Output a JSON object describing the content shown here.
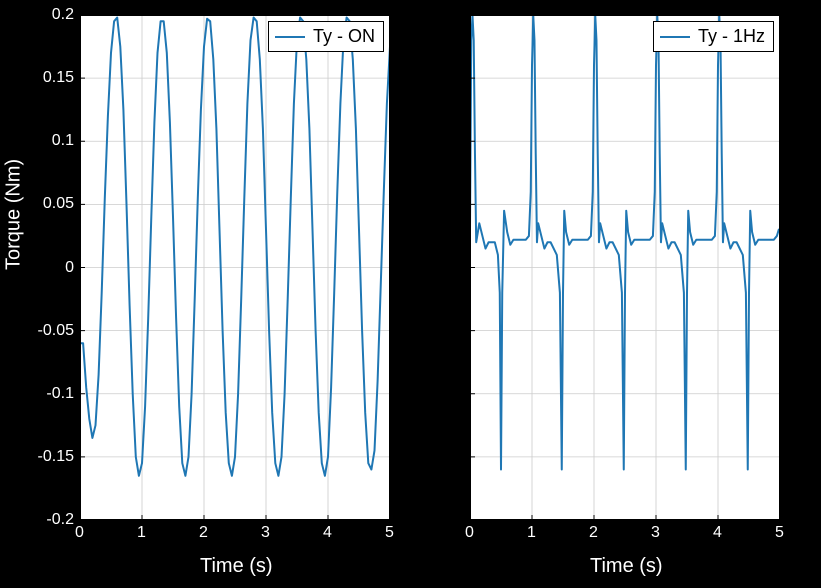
{
  "chart_data": [
    {
      "type": "line",
      "title": "",
      "xlabel": "Time (s)",
      "ylabel": "Torque (Nm)",
      "xlim": [
        0,
        5
      ],
      "ylim": [
        -0.2,
        0.2
      ],
      "xticks": [
        0,
        1,
        2,
        3,
        4,
        5
      ],
      "yticks": [
        -0.2,
        -0.15,
        -0.1,
        -0.05,
        0,
        0.05,
        0.1,
        0.15,
        0.2
      ],
      "legend": [
        "Ty - ON"
      ],
      "legend_pos": "upper right",
      "series": [
        {
          "name": "Ty - ON",
          "color": "#1f77b4",
          "x": [
            0,
            0.05,
            0.1,
            0.15,
            0.2,
            0.25,
            0.3,
            0.35,
            0.4,
            0.45,
            0.5,
            0.55,
            0.6,
            0.65,
            0.7,
            0.75,
            0.8,
            0.85,
            0.9,
            0.95,
            1.0,
            1.05,
            1.1,
            1.15,
            1.2,
            1.25,
            1.3,
            1.35,
            1.4,
            1.45,
            1.5,
            1.55,
            1.6,
            1.65,
            1.7,
            1.75,
            1.8,
            1.85,
            1.9,
            1.95,
            2.0,
            2.05,
            2.1,
            2.15,
            2.2,
            2.25,
            2.3,
            2.35,
            2.4,
            2.45,
            2.5,
            2.55,
            2.6,
            2.65,
            2.7,
            2.75,
            2.8,
            2.85,
            2.9,
            2.95,
            3.0,
            3.05,
            3.1,
            3.15,
            3.2,
            3.25,
            3.3,
            3.35,
            3.4,
            3.45,
            3.5,
            3.55,
            3.6,
            3.65,
            3.7,
            3.75,
            3.8,
            3.85,
            3.9,
            3.95,
            4.0,
            4.05,
            4.1,
            4.15,
            4.2,
            4.25,
            4.3,
            4.35,
            4.4,
            4.45,
            4.5,
            4.55,
            4.6,
            4.65,
            4.7,
            4.75,
            4.8,
            4.85,
            4.9,
            4.95,
            5.0
          ],
          "y": [
            -0.06,
            -0.06,
            -0.095,
            -0.12,
            -0.135,
            -0.125,
            -0.085,
            -0.02,
            0.055,
            0.12,
            0.17,
            0.195,
            0.198,
            0.175,
            0.125,
            0.05,
            -0.03,
            -0.1,
            -0.15,
            -0.165,
            -0.155,
            -0.11,
            -0.04,
            0.04,
            0.115,
            0.17,
            0.195,
            0.195,
            0.17,
            0.115,
            0.04,
            -0.04,
            -0.11,
            -0.155,
            -0.165,
            -0.15,
            -0.1,
            -0.025,
            0.055,
            0.125,
            0.175,
            0.197,
            0.195,
            0.165,
            0.11,
            0.03,
            -0.05,
            -0.115,
            -0.155,
            -0.165,
            -0.15,
            -0.1,
            -0.025,
            0.055,
            0.13,
            0.18,
            0.198,
            0.195,
            0.165,
            0.11,
            0.03,
            -0.05,
            -0.115,
            -0.155,
            -0.165,
            -0.15,
            -0.1,
            -0.025,
            0.055,
            0.13,
            0.18,
            0.198,
            0.195,
            0.165,
            0.11,
            0.03,
            -0.05,
            -0.115,
            -0.155,
            -0.165,
            -0.15,
            -0.095,
            -0.02,
            0.06,
            0.13,
            0.18,
            0.198,
            0.195,
            0.165,
            0.11,
            0.03,
            -0.05,
            -0.115,
            -0.155,
            -0.16,
            -0.145,
            -0.09,
            -0.015,
            0.06,
            0.13,
            0.175
          ]
        }
      ]
    },
    {
      "type": "line",
      "title": "",
      "xlabel": "Time (s)",
      "ylabel": "",
      "xlim": [
        0,
        5
      ],
      "ylim": [
        -0.2,
        0.2
      ],
      "xticks": [
        0,
        1,
        2,
        3,
        4,
        5
      ],
      "yticks": [
        -0.2,
        -0.15,
        -0.1,
        -0.05,
        0,
        0.05,
        0.1,
        0.15,
        0.2
      ],
      "legend": [
        "Ty - 1Hz"
      ],
      "legend_pos": "upper right",
      "series": [
        {
          "name": "Ty - 1Hz",
          "color": "#1f77b4",
          "x": [
            0.0,
            0.02,
            0.04,
            0.06,
            0.08,
            0.1,
            0.15,
            0.2,
            0.25,
            0.3,
            0.4,
            0.45,
            0.48,
            0.5,
            0.52,
            0.55,
            0.6,
            0.65,
            0.7,
            0.8,
            0.9,
            0.95,
            0.98,
            1.0,
            1.02,
            1.04,
            1.06,
            1.08,
            1.1,
            1.15,
            1.2,
            1.25,
            1.3,
            1.4,
            1.45,
            1.48,
            1.5,
            1.52,
            1.55,
            1.6,
            1.65,
            1.7,
            1.8,
            1.9,
            1.95,
            1.98,
            2.0,
            2.02,
            2.04,
            2.06,
            2.08,
            2.1,
            2.15,
            2.2,
            2.25,
            2.3,
            2.4,
            2.45,
            2.48,
            2.5,
            2.52,
            2.55,
            2.6,
            2.65,
            2.7,
            2.8,
            2.9,
            2.95,
            2.98,
            3.0,
            3.02,
            3.04,
            3.06,
            3.08,
            3.1,
            3.15,
            3.2,
            3.25,
            3.3,
            3.4,
            3.45,
            3.48,
            3.5,
            3.52,
            3.55,
            3.6,
            3.65,
            3.7,
            3.8,
            3.9,
            3.95,
            3.98,
            4.0,
            4.02,
            4.04,
            4.06,
            4.08,
            4.1,
            4.15,
            4.2,
            4.25,
            4.3,
            4.4,
            4.45,
            4.48,
            4.5,
            4.52,
            4.55,
            4.6,
            4.65,
            4.7,
            4.8,
            4.9,
            4.95,
            4.98,
            5.0
          ],
          "y": [
            0.03,
            0.18,
            0.2,
            0.18,
            0.09,
            0.02,
            0.035,
            0.025,
            0.015,
            0.02,
            0.02,
            0.01,
            -0.02,
            -0.16,
            -0.02,
            0.045,
            0.028,
            0.018,
            0.022,
            0.022,
            0.022,
            0.025,
            0.06,
            0.16,
            0.2,
            0.18,
            0.09,
            0.02,
            0.035,
            0.025,
            0.015,
            0.02,
            0.02,
            0.01,
            -0.02,
            -0.16,
            -0.02,
            0.045,
            0.028,
            0.018,
            0.022,
            0.022,
            0.022,
            0.022,
            0.025,
            0.06,
            0.16,
            0.2,
            0.18,
            0.09,
            0.02,
            0.035,
            0.025,
            0.015,
            0.02,
            0.02,
            0.01,
            -0.02,
            -0.16,
            -0.02,
            0.045,
            0.028,
            0.018,
            0.022,
            0.022,
            0.022,
            0.022,
            0.025,
            0.06,
            0.16,
            0.2,
            0.18,
            0.09,
            0.02,
            0.035,
            0.025,
            0.015,
            0.02,
            0.02,
            0.01,
            -0.02,
            -0.16,
            -0.02,
            0.045,
            0.028,
            0.018,
            0.022,
            0.022,
            0.022,
            0.022,
            0.025,
            0.06,
            0.16,
            0.2,
            0.18,
            0.09,
            0.02,
            0.035,
            0.025,
            0.015,
            0.02,
            0.02,
            0.01,
            -0.02,
            -0.16,
            -0.02,
            0.045,
            0.028,
            0.018,
            0.022,
            0.022,
            0.022,
            0.022,
            0.025,
            0.03,
            0.03
          ]
        }
      ]
    }
  ]
}
